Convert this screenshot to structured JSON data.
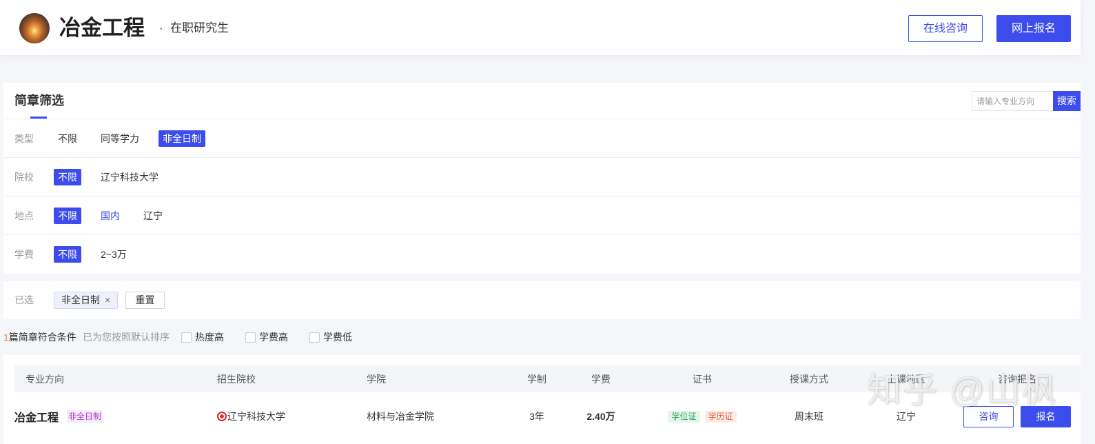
{
  "header": {
    "title": "冶金工程",
    "separator": "·",
    "subtitle": "在职研究生",
    "consult_label": "在线咨询",
    "apply_label": "网上报名"
  },
  "filter": {
    "title": "简章筛选",
    "search": {
      "placeholder": "请输入专业方向",
      "value": "",
      "button_label": "搜索"
    },
    "rows": [
      {
        "label": "类型",
        "options": [
          {
            "text": "不限",
            "selected": false
          },
          {
            "text": "同等学力",
            "selected": false
          },
          {
            "text": "非全日制",
            "selected": true
          }
        ]
      },
      {
        "label": "院校",
        "options": [
          {
            "text": "不限",
            "selected": true
          },
          {
            "text": "辽宁科技大学",
            "selected": false
          }
        ]
      },
      {
        "label": "地点",
        "options": [
          {
            "text": "不限",
            "selected": true
          },
          {
            "text": "国内",
            "selected": false,
            "highlighted": true
          },
          {
            "text": "辽宁",
            "selected": false
          }
        ]
      },
      {
        "label": "学费",
        "options": [
          {
            "text": "不限",
            "selected": true
          },
          {
            "text": "2~3万",
            "selected": false
          }
        ]
      }
    ]
  },
  "selected_filters": {
    "label": "已选",
    "chips": [
      {
        "text": "非全日制",
        "remove_icon": "×",
        "icon": "close-icon"
      }
    ],
    "reset_label": "重置"
  },
  "sort_bar": {
    "count": "1",
    "count_suffix": "篇简章符合条件",
    "hint": "已为您按照默认排序",
    "options": [
      {
        "label": "热度高",
        "checked": false
      },
      {
        "label": "学费高",
        "checked": false
      },
      {
        "label": "学费低",
        "checked": false
      }
    ]
  },
  "table": {
    "columns": [
      "专业方向",
      "招生院校",
      "学院",
      "学制",
      "学费",
      "证书",
      "授课方式",
      "上课地区",
      "咨询报名"
    ],
    "rows": [
      {
        "program": "冶金工程",
        "type_badge": "非全日制",
        "school_icon": "school-logo-icon",
        "school": "辽宁科技大学",
        "college": "材料与冶金学院",
        "duration": "3年",
        "fee": "2.40万",
        "certificates": [
          "学位证",
          "学历证"
        ],
        "mode": "周末班",
        "region": "辽宁",
        "consult_label": "咨询",
        "apply_label": "报名"
      }
    ]
  },
  "watermark": "知乎 @山枫",
  "colors": {
    "primary": "#3d4ded",
    "fee": "#e53935",
    "count": "#f08a24",
    "type_badge_text": "#b13fc6",
    "type_badge_bg": "#f8ebfa",
    "degree_text": "#2ea45f",
    "degree_bg": "#e5f6ec",
    "diploma_text": "#e2603a",
    "diploma_bg": "#fdece6"
  }
}
